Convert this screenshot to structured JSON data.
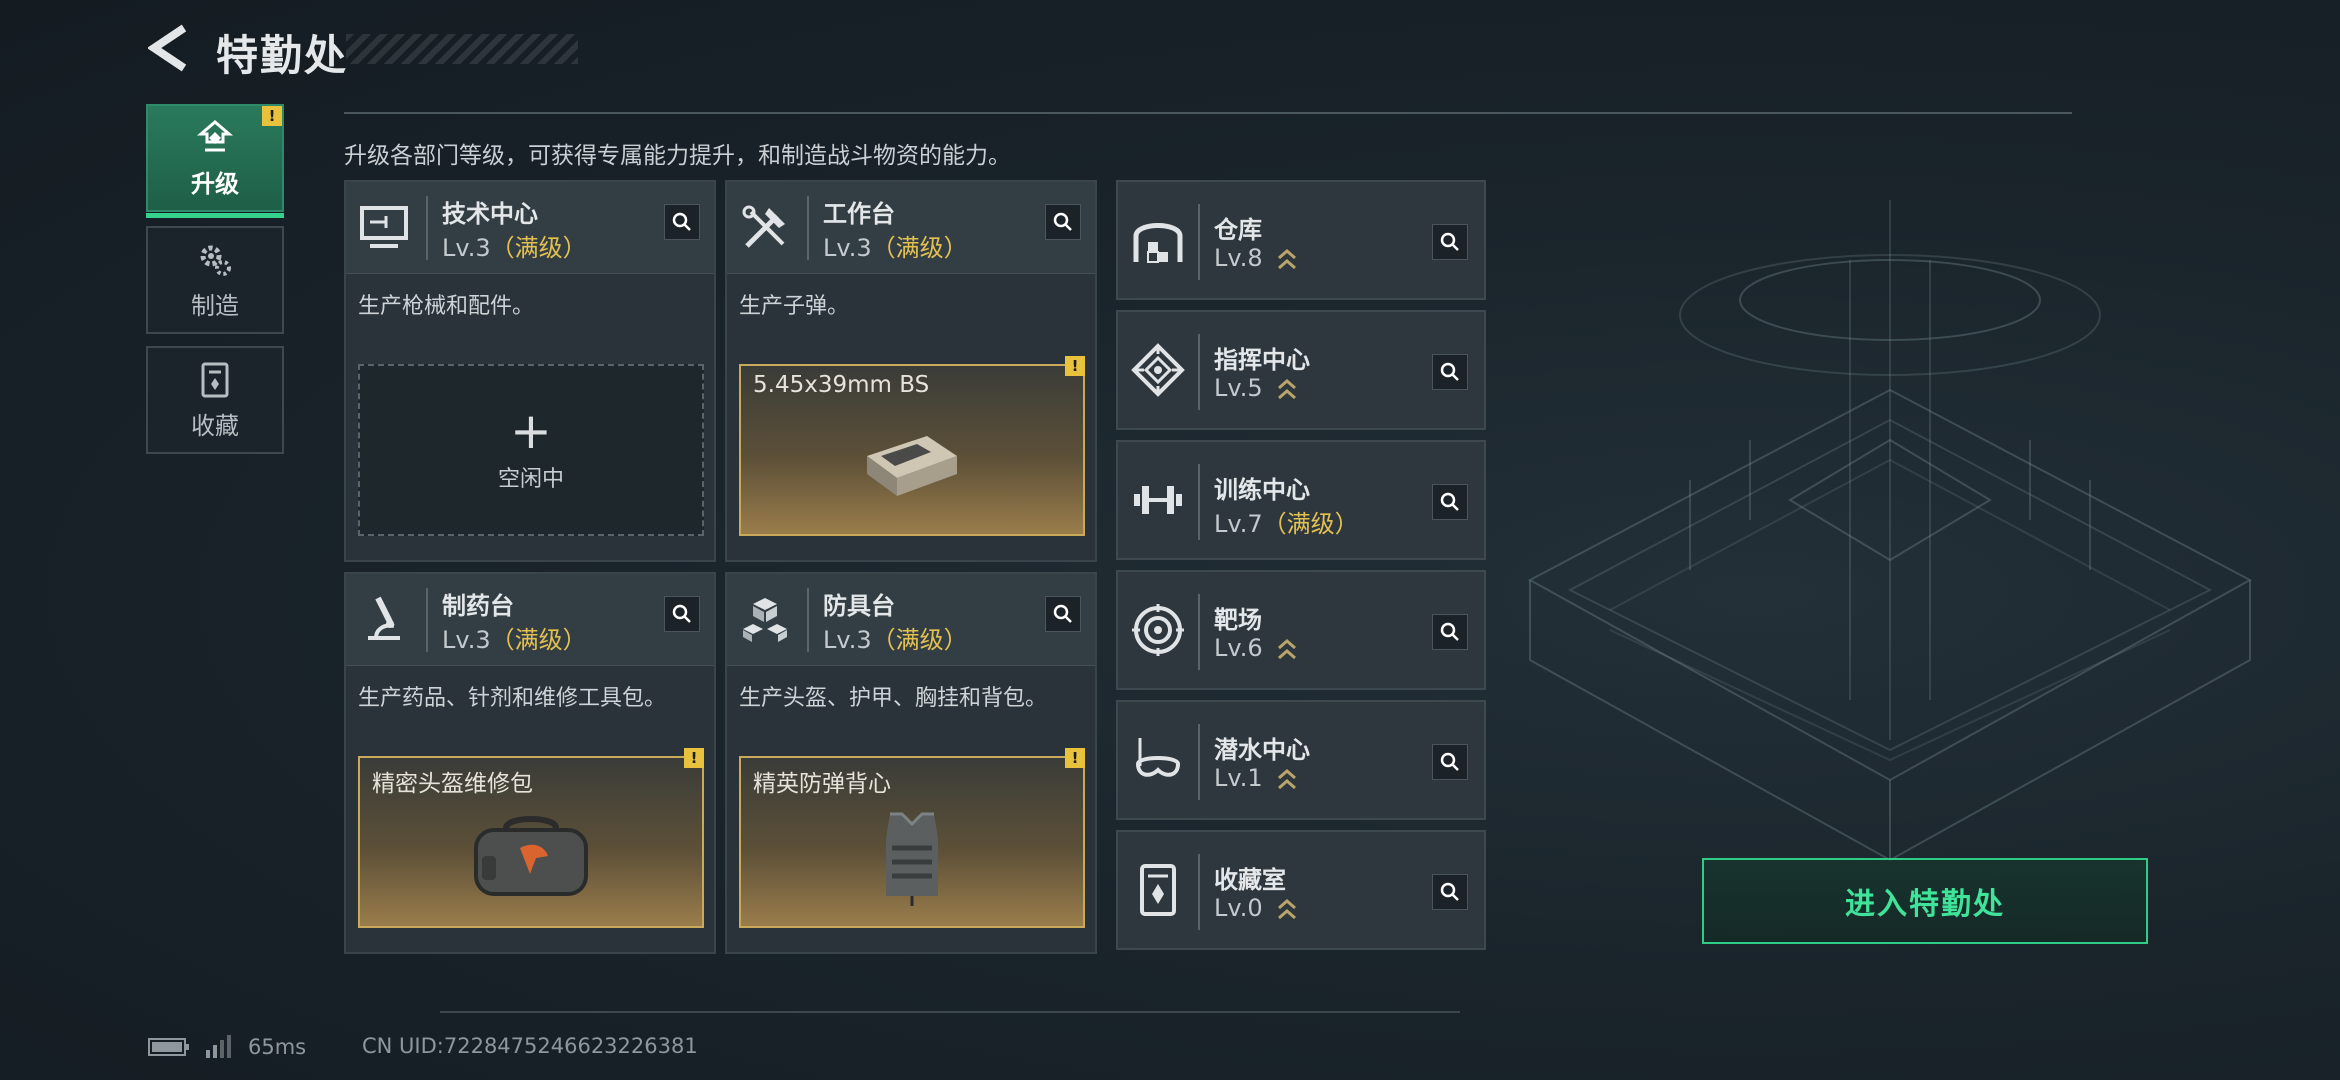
{
  "header": {
    "title": "特勤处"
  },
  "tabs": [
    {
      "label": "升级",
      "active": true,
      "warning": "!"
    },
    {
      "label": "制造",
      "active": false
    },
    {
      "label": "收藏",
      "active": false
    }
  ],
  "description": "升级各部门等级，可获得专属能力提升，和制造战斗物资的能力。",
  "facilities_large": [
    {
      "name": "技术中心",
      "level": "Lv.3",
      "maxed_label": "（满级）",
      "desc": "生产枪械和配件。",
      "slot": {
        "type": "empty",
        "plus": "+",
        "label": "空闲中"
      }
    },
    {
      "name": "工作台",
      "level": "Lv.3",
      "maxed_label": "（满级）",
      "desc": "生产子弹。",
      "slot": {
        "type": "item",
        "name": "5.45x39mm BS",
        "warning": "!"
      }
    },
    {
      "name": "制药台",
      "level": "Lv.3",
      "maxed_label": "（满级）",
      "desc": "生产药品、针剂和维修工具包。",
      "slot": {
        "type": "item",
        "name": "精密头盔维修包",
        "warning": "!"
      }
    },
    {
      "name": "防具台",
      "level": "Lv.3",
      "maxed_label": "（满级）",
      "desc": "生产头盔、护甲、胸挂和背包。",
      "slot": {
        "type": "item",
        "name": "精英防弹背心",
        "warning": "!"
      }
    }
  ],
  "facilities_small": [
    {
      "name": "仓库",
      "level": "Lv.8",
      "maxed_label": ""
    },
    {
      "name": "指挥中心",
      "level": "Lv.5",
      "maxed_label": ""
    },
    {
      "name": "训练中心",
      "level": "Lv.7",
      "maxed_label": "（满级）"
    },
    {
      "name": "靶场",
      "level": "Lv.6",
      "maxed_label": ""
    },
    {
      "name": "潜水中心",
      "level": "Lv.1",
      "maxed_label": ""
    },
    {
      "name": "收藏室",
      "level": "Lv.0",
      "maxed_label": ""
    }
  ],
  "enter_button": "进入特勤处",
  "status": {
    "ping": "65ms",
    "uid": "CN UID:7228475246623226381"
  },
  "colors": {
    "accent_green": "#3fe39a",
    "maxed_gold": "#e2c052",
    "item_border": "#c9a95a"
  }
}
